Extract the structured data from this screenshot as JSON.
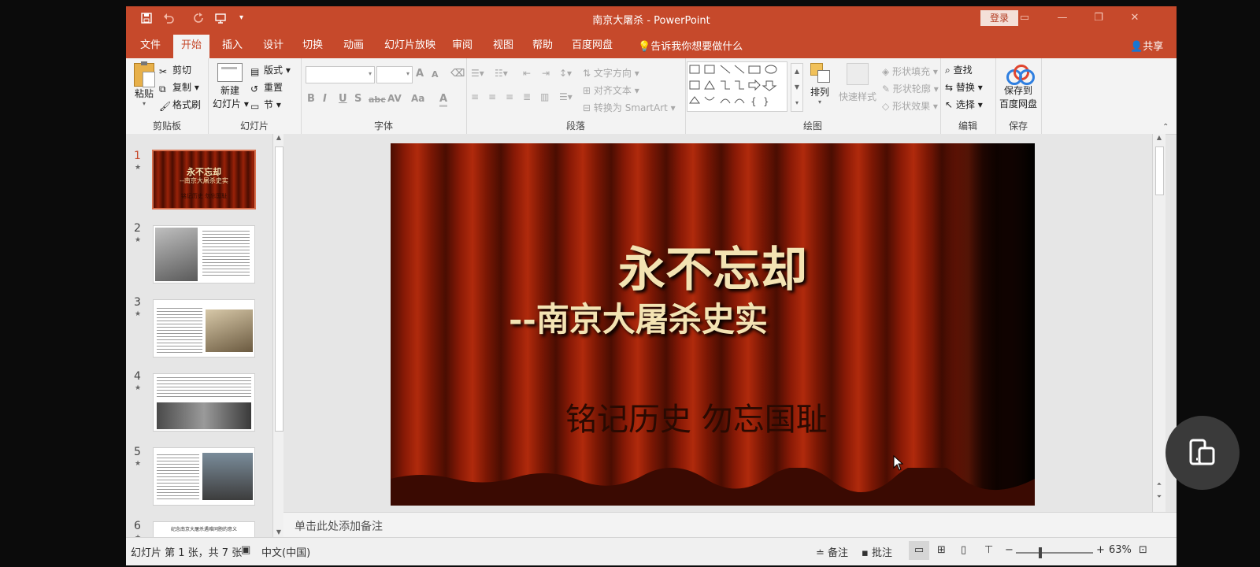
{
  "window": {
    "title": "南京大屠杀 - PowerPoint",
    "login_label": "登录"
  },
  "tabs": [
    {
      "label": "文件"
    },
    {
      "label": "开始"
    },
    {
      "label": "插入"
    },
    {
      "label": "设计"
    },
    {
      "label": "切换"
    },
    {
      "label": "动画"
    },
    {
      "label": "幻灯片放映"
    },
    {
      "label": "审阅"
    },
    {
      "label": "视图"
    },
    {
      "label": "帮助"
    },
    {
      "label": "百度网盘"
    }
  ],
  "tell_me": "告诉我你想要做什么",
  "share_label": "共享",
  "ribbon": {
    "clipboard": {
      "label": "剪贴板",
      "paste": "粘贴",
      "cut": "剪切",
      "copy": "复制",
      "format_painter": "格式刷"
    },
    "slides": {
      "label": "幻灯片",
      "new_slide_1": "新建",
      "new_slide_2": "幻灯片",
      "layout": "版式",
      "reset": "重置",
      "section": "节"
    },
    "font": {
      "label": "字体",
      "bold": "B",
      "italic": "I",
      "underline": "U",
      "shadow": "S",
      "strike": "abc",
      "spacing": "AV",
      "case": "Aa",
      "color": "A",
      "grow": "A",
      "shrink": "A"
    },
    "paragraph": {
      "label": "段落",
      "text_direction": "文字方向",
      "align_text": "对齐文本",
      "convert_smartart": "转换为 SmartArt"
    },
    "drawing": {
      "label": "绘图",
      "arrange": "排列",
      "quick_styles": "快速样式",
      "shape_fill": "形状填充",
      "shape_outline": "形状轮廓",
      "shape_effects": "形状效果"
    },
    "editing": {
      "label": "编辑",
      "find": "查找",
      "replace": "替换",
      "select": "选择"
    },
    "save": {
      "label": "保存",
      "save_to_1": "保存到",
      "save_to_2": "百度网盘"
    }
  },
  "thumbnails": [
    {
      "num": "1",
      "title": "永不忘却",
      "subtitle": "--南京大屠杀史实",
      "motto": "铭记历史 勿忘国耻"
    },
    {
      "num": "2"
    },
    {
      "num": "3"
    },
    {
      "num": "4"
    },
    {
      "num": "5"
    },
    {
      "num": "6",
      "title": "纪念南京大屠杀遇难同胞的意义"
    }
  ],
  "slide": {
    "title": "永不忘却",
    "subtitle": "--南京大屠杀史实",
    "motto": "铭记历史 勿忘国耻"
  },
  "notes_placeholder": "单击此处添加备注",
  "status": {
    "slide_info": "幻灯片 第 1 张，共 7 张",
    "language": "中文(中国)",
    "notes": "备注",
    "comments": "批注",
    "zoom": "63%",
    "zoom_level": 0.63
  },
  "colors": {
    "accent": "#c6492b",
    "ribbon_bg": "#f3f3f3"
  }
}
